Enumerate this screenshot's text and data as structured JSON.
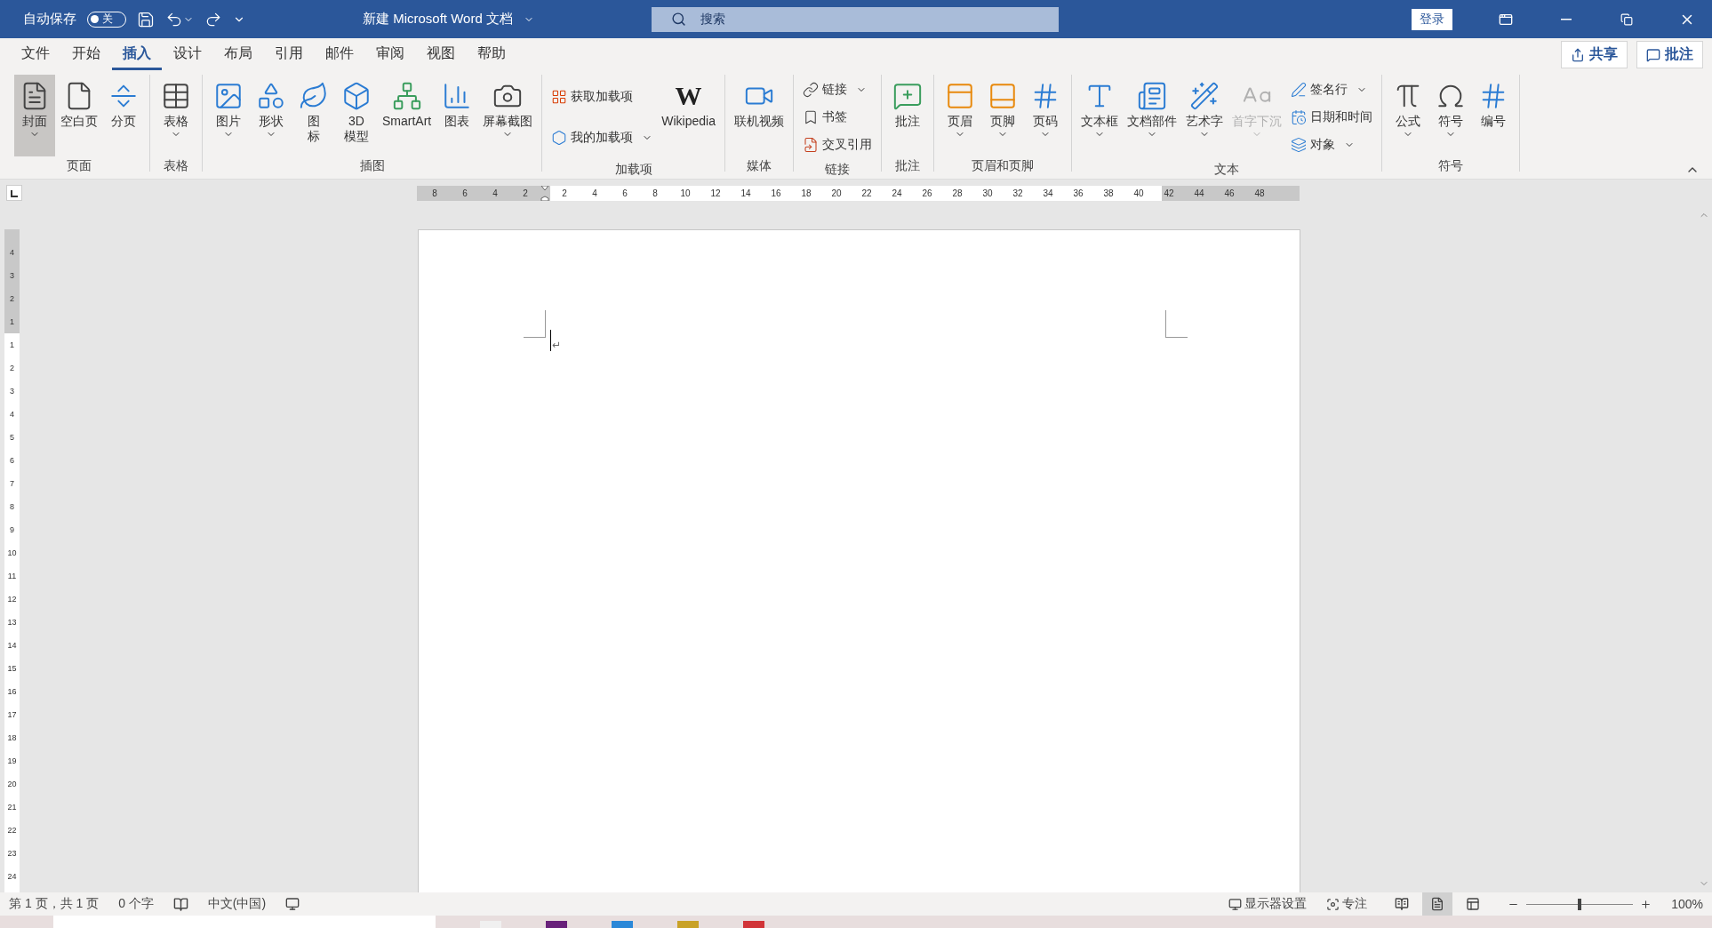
{
  "title_bar": {
    "autosave": {
      "label": "自动保存",
      "on": false,
      "state": "关"
    },
    "document_title": "新建 Microsoft Word 文档",
    "search": {
      "placeholder": "搜索"
    },
    "sign_in": "登录"
  },
  "tabs": [
    {
      "label": "文件",
      "selected": false
    },
    {
      "label": "开始",
      "selected": false
    },
    {
      "label": "插入",
      "selected": true
    },
    {
      "label": "设计",
      "selected": false
    },
    {
      "label": "布局",
      "selected": false
    },
    {
      "label": "引用",
      "selected": false
    },
    {
      "label": "邮件",
      "selected": false
    },
    {
      "label": "审阅",
      "selected": false
    },
    {
      "label": "视图",
      "selected": false
    },
    {
      "label": "帮助",
      "selected": false
    }
  ],
  "share": "共享",
  "comments": "批注",
  "ribbon": [
    {
      "label": "页面",
      "items": [
        {
          "kind": "large",
          "label": "封面",
          "menu": true,
          "hovered": true,
          "disabled": false
        },
        {
          "kind": "large",
          "label": "空白页",
          "menu": false,
          "hovered": false,
          "disabled": false
        },
        {
          "kind": "large",
          "label": "分页",
          "menu": false,
          "hovered": false,
          "disabled": false
        }
      ]
    },
    {
      "label": "表格",
      "items": [
        {
          "kind": "large",
          "label": "表格",
          "menu": true,
          "hovered": false,
          "disabled": false
        }
      ]
    },
    {
      "label": "插图",
      "items": [
        {
          "kind": "large",
          "label": "图片",
          "menu": true,
          "hovered": false,
          "disabled": false
        },
        {
          "kind": "large",
          "label": "形状",
          "menu": true,
          "hovered": false,
          "disabled": false
        },
        {
          "kind": "narrow",
          "label": "图标",
          "menu": false,
          "hovered": false,
          "disabled": false
        },
        {
          "kind": "two-line",
          "label": "3D 模型",
          "menu": false,
          "hovered": false,
          "disabled": false
        },
        {
          "kind": "large",
          "label": "SmartArt",
          "menu": false,
          "hovered": false,
          "disabled": false
        },
        {
          "kind": "large",
          "label": "图表",
          "menu": false,
          "hovered": false,
          "disabled": false
        },
        {
          "kind": "large",
          "label": "屏幕截图",
          "menu": true,
          "hovered": false,
          "disabled": false
        }
      ]
    },
    {
      "label": "加载项",
      "items": [
        {
          "kind": "stack",
          "items": [
            {
              "label": "获取加载项",
              "menu": false
            },
            {
              "label": "我的加载项",
              "menu": true
            }
          ]
        },
        {
          "kind": "large",
          "label": "Wikipedia",
          "glyph": "W",
          "menu": false,
          "hovered": false,
          "disabled": false
        }
      ]
    },
    {
      "label": "媒体",
      "items": [
        {
          "kind": "large",
          "label": "联机视频",
          "menu": false,
          "hovered": false,
          "disabled": false
        }
      ]
    },
    {
      "label": "链接",
      "items": [
        {
          "kind": "stack",
          "items": [
            {
              "label": "链接",
              "menu": true
            },
            {
              "label": "书签",
              "menu": false
            },
            {
              "label": "交叉引用",
              "menu": false
            }
          ]
        }
      ]
    },
    {
      "label": "批注",
      "items": [
        {
          "kind": "large",
          "label": "批注",
          "menu": false,
          "hovered": false,
          "disabled": false
        }
      ]
    },
    {
      "label": "页眉和页脚",
      "items": [
        {
          "kind": "large",
          "label": "页眉",
          "menu": true,
          "hovered": false,
          "disabled": false
        },
        {
          "kind": "large",
          "label": "页脚",
          "menu": true,
          "hovered": false,
          "disabled": false
        },
        {
          "kind": "large",
          "label": "页码",
          "menu": true,
          "hovered": false,
          "disabled": false
        }
      ]
    },
    {
      "label": "文本",
      "items": [
        {
          "kind": "large",
          "label": "文本框",
          "menu": true,
          "hovered": false,
          "disabled": false
        },
        {
          "kind": "large",
          "label": "文档部件",
          "menu": true,
          "hovered": false,
          "disabled": false
        },
        {
          "kind": "large",
          "label": "艺术字",
          "menu": true,
          "hovered": false,
          "disabled": false
        },
        {
          "kind": "large",
          "label": "首字下沉",
          "menu": true,
          "hovered": false,
          "disabled": true
        },
        {
          "kind": "stack",
          "items": [
            {
              "label": "签名行",
              "menu": true
            },
            {
              "label": "日期和时间",
              "menu": false
            },
            {
              "label": "对象",
              "menu": true
            }
          ]
        }
      ]
    },
    {
      "label": "符号",
      "items": [
        {
          "kind": "large",
          "label": "公式",
          "menu": true,
          "hovered": false,
          "disabled": false
        },
        {
          "kind": "large",
          "label": "符号",
          "menu": true,
          "hovered": false,
          "disabled": false
        },
        {
          "kind": "large",
          "label": "编号",
          "menu": false,
          "hovered": false,
          "disabled": false
        }
      ]
    }
  ],
  "ruler": {
    "labels": [
      "8",
      "6",
      "4",
      "2",
      "2",
      "4",
      "6",
      "8",
      "10",
      "12",
      "14",
      "16",
      "18",
      "20",
      "22",
      "24",
      "26",
      "28",
      "30",
      "32",
      "34",
      "36",
      "38",
      "40",
      "42",
      "44",
      "46",
      "48"
    ]
  },
  "vertical_ruler": {
    "labels": [
      "4",
      "3",
      "2",
      "1",
      "1",
      "2",
      "3",
      "4",
      "5",
      "6",
      "7",
      "8",
      "9",
      "10",
      "11",
      "12",
      "13",
      "14",
      "15",
      "16",
      "17",
      "18",
      "19",
      "20",
      "21",
      "22",
      "23",
      "24"
    ]
  },
  "document": {
    "paragraph_mark": "↵"
  },
  "status_bar": {
    "page": "第 1 页，共 1 页",
    "words": "0 个字",
    "language": "中文(中国)",
    "display_settings": "显示器设置",
    "focus": "专注",
    "views": [
      {
        "selected": false
      },
      {
        "selected": true
      },
      {
        "selected": false
      }
    ],
    "zoom": {
      "level": 0.5,
      "reading": "100%"
    }
  }
}
